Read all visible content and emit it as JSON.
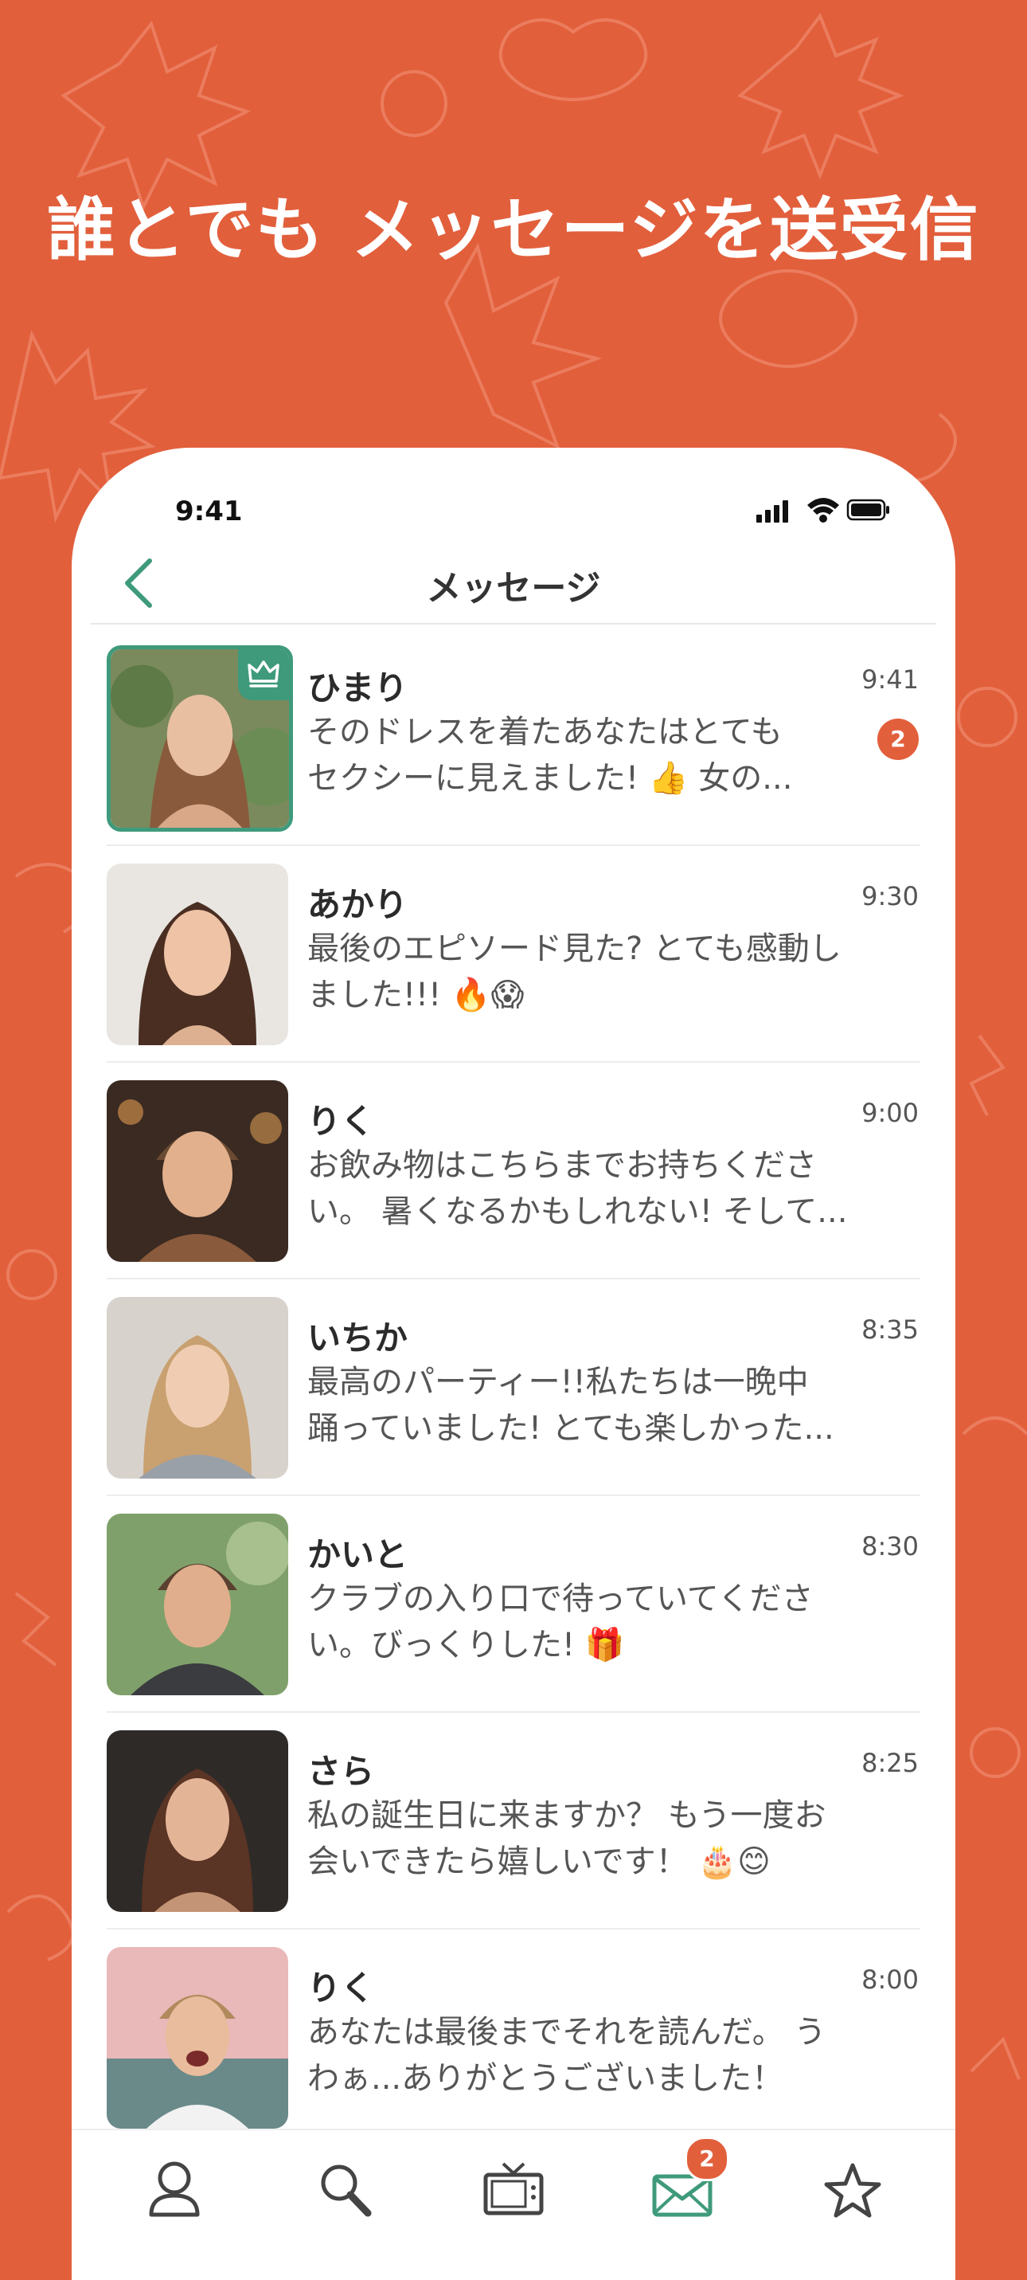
{
  "headline": "誰とでも メッセージを送受信",
  "status_bar": {
    "time": "9:41",
    "icons": [
      "signal-icon",
      "wifi-icon",
      "battery-icon"
    ]
  },
  "nav": {
    "back_icon": "chevron-left-icon",
    "title": "メッセージ"
  },
  "conversations": [
    {
      "name": "ひまり",
      "time": "9:41",
      "line1": "そのドレスを着たあなたはとても",
      "line2": "セクシーに見えました! 👍 女の...",
      "unread": "2",
      "selected": true,
      "premium": true
    },
    {
      "name": "あかり",
      "time": "9:30",
      "line1": "最後のエピソード見た? とても感動し",
      "line2": "ました!!! 🔥😱"
    },
    {
      "name": "りく",
      "time": "9:00",
      "line1": "お飲み物はこちらまでお持ちくださ",
      "line2": "い。 暑くなるかもしれない! そして..."
    },
    {
      "name": "いちか",
      "time": "8:35",
      "line1": "最高のパーティー!!私たちは一晩中",
      "line2": "踊っていました! とても楽しかった..."
    },
    {
      "name": "かいと",
      "time": "8:30",
      "line1": "クラブの入り口で待っていてくださ",
      "line2": "い。びっくりした! 🎁"
    },
    {
      "name": "さら",
      "time": "8:25",
      "line1": "私の誕生日に来ますか？ もう一度お",
      "line2": "会いできたら嬉しいです！ 🎂😊"
    },
    {
      "name": "りく",
      "time": "8:00",
      "line1": "あなたは最後までそれを読んだ。 う",
      "line2": "わぁ...ありがとうございました！"
    }
  ],
  "tab_bar": {
    "tabs": [
      "profile-icon",
      "search-icon",
      "tv-icon",
      "mail-icon",
      "star-icon"
    ],
    "active": "mail-icon",
    "mail_badge": "2"
  },
  "colors": {
    "background": "#e25f3c",
    "accent_green": "#3f9a7c",
    "badge": "#e25f3c"
  }
}
